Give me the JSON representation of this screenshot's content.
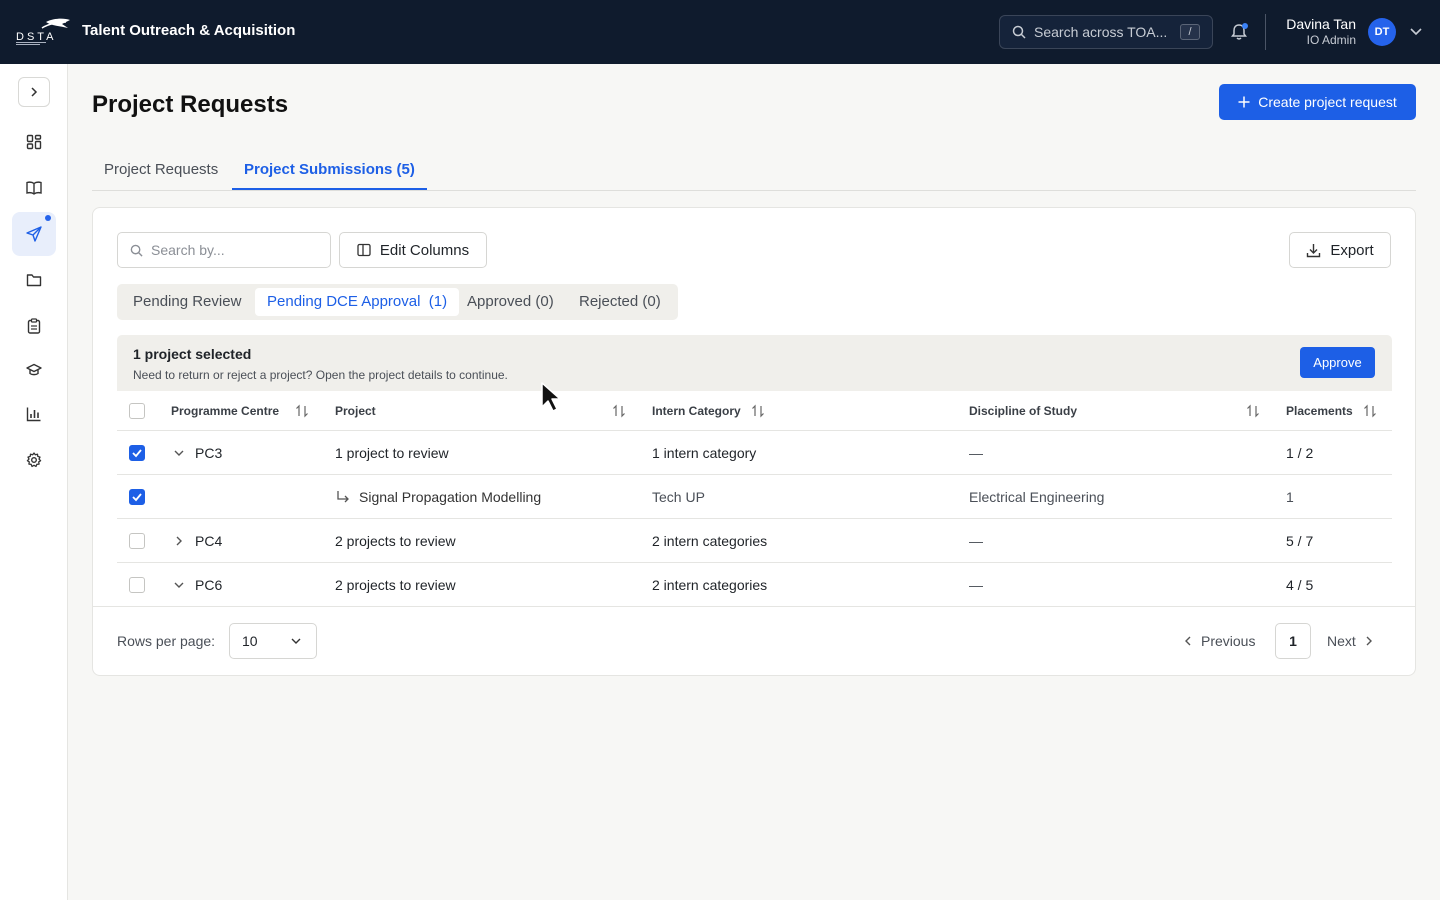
{
  "header": {
    "logo_text": "DSTA",
    "app_title": "Talent Outreach & Acquisition",
    "search_placeholder": "Search across TOA...",
    "search_shortcut": "/",
    "user_name": "Davina Tan",
    "user_role": "IO Admin",
    "avatar_initials": "DT"
  },
  "sidebar": {
    "items": [
      {
        "icon": "dashboard-grid-icon"
      },
      {
        "icon": "book-icon"
      },
      {
        "icon": "send-icon",
        "active": true,
        "has_notification": true
      },
      {
        "icon": "folder-icon"
      },
      {
        "icon": "clipboard-icon"
      },
      {
        "icon": "graduation-cap-icon"
      },
      {
        "icon": "bar-chart-icon"
      },
      {
        "icon": "gear-icon"
      }
    ]
  },
  "page": {
    "title": "Project Requests",
    "create_button": "Create project request",
    "tabs": [
      {
        "label": "Project Requests",
        "active": false
      },
      {
        "label": "Project Submissions (5)",
        "active": true
      }
    ]
  },
  "toolbar": {
    "search_placeholder": "Search by...",
    "edit_columns": "Edit Columns",
    "export": "Export"
  },
  "status_tabs": [
    {
      "label": "Pending Review",
      "active": false
    },
    {
      "label": "Pending DCE Approval  (1)",
      "active": true
    },
    {
      "label": "Approved (0)",
      "active": false
    },
    {
      "label": "Rejected (0)",
      "active": false
    }
  ],
  "selection": {
    "title": "1 project selected",
    "subtitle": "Need to return or reject a project? Open the project details to continue.",
    "approve_button": "Approve"
  },
  "table": {
    "columns": [
      "Programme Centre",
      "Project",
      "Intern Category",
      "Discipline of Study",
      "Placements"
    ],
    "rows": [
      {
        "checked": true,
        "expand": "down",
        "centre": "PC3",
        "project": "1 project to review",
        "category": "1 intern category",
        "discipline": "—",
        "placements": "1 / 2"
      },
      {
        "checked": true,
        "child": true,
        "centre": "",
        "project": "Signal Propagation Modelling",
        "category": "Tech UP",
        "discipline": "Electrical Engineering",
        "placements": "1"
      },
      {
        "checked": false,
        "expand": "right",
        "centre": "PC4",
        "project": "2 projects to review",
        "category": "2 intern categories",
        "discipline": "—",
        "placements": "5 / 7"
      },
      {
        "checked": false,
        "expand": "down",
        "centre": "PC6",
        "project": "2 projects to review",
        "category": "2 intern categories",
        "discipline": "—",
        "placements": "4 / 5"
      }
    ]
  },
  "pagination": {
    "rows_per_page_label": "Rows per page:",
    "rows_per_page_value": "10",
    "previous": "Previous",
    "current_page": "1",
    "next": "Next"
  },
  "colors": {
    "header_bg": "#0f1b2d",
    "accent": "#1d5fe6"
  }
}
